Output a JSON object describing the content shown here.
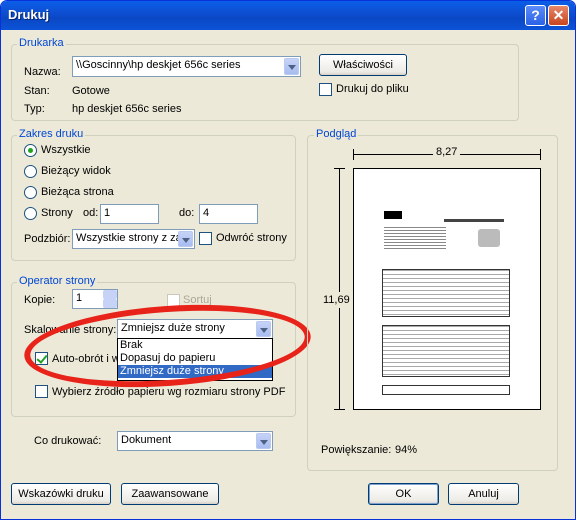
{
  "window": {
    "title": "Drukuj",
    "help_btn": "?",
    "close_btn": "✕"
  },
  "printer": {
    "group": "Drukarka",
    "name_label": "Nazwa:",
    "name_value": "\\\\Goscinny\\hp deskjet 656c series",
    "properties_btn": "Właściwości",
    "status_label": "Stan:",
    "status_value": "Gotowe",
    "type_label": "Typ:",
    "type_value": "hp deskjet 656c series",
    "print_to_file": "Drukuj do pliku"
  },
  "range": {
    "group": "Zakres druku",
    "all": "Wszystkie",
    "current_view": "Bieżący widok",
    "current_page": "Bieżąca strona",
    "pages": "Strony",
    "from_label": "od:",
    "from_value": "1",
    "to_label": "do:",
    "to_value": "4",
    "subset_label": "Podzbiór:",
    "subset_value": "Wszystkie strony z za",
    "reverse": "Odwróć strony"
  },
  "handling": {
    "group": "Operator strony",
    "copies_label": "Kopie:",
    "copies_value": "1",
    "collate": "Sortuj",
    "scaling_label": "Skalowanie strony:",
    "scaling_value": "Zmniejsz duże strony",
    "scaling_options": [
      "Brak",
      "Dopasuj do papieru",
      "Zmniejsz duże strony"
    ],
    "autorotate": "Auto-obrót i w",
    "choose_paper": "Wybierz źródło papieru wg rozmiaru strony PDF"
  },
  "what": {
    "label": "Co drukować:",
    "value": "Dokument"
  },
  "preview": {
    "group": "Podgląd",
    "width": "8,27",
    "height": "11,69",
    "zoom_label": "Powiększanie:",
    "zoom_value": "94%"
  },
  "footer": {
    "tips_btn": "Wskazówki druku",
    "advanced_btn": "Zaawansowane",
    "ok_btn": "OK",
    "cancel_btn": "Anuluj"
  }
}
